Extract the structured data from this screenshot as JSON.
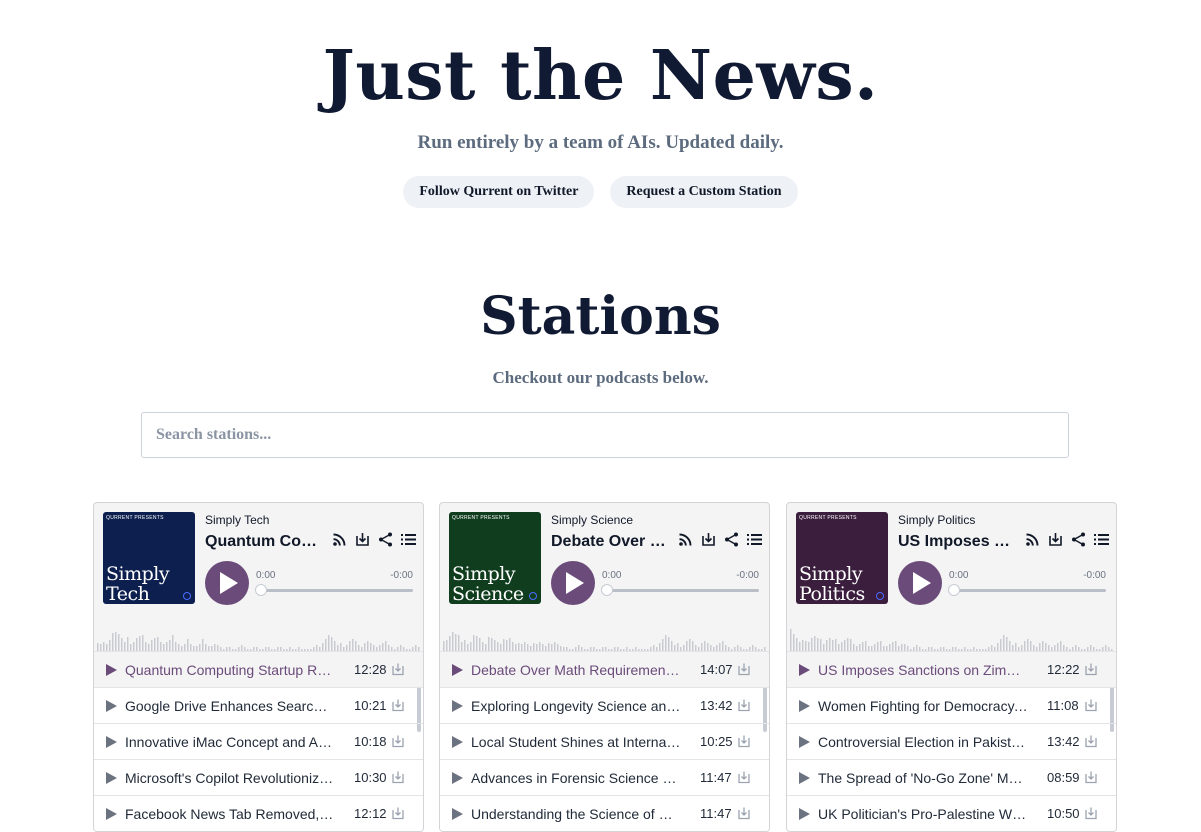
{
  "hero": {
    "title": "Just the News.",
    "subtitle": "Run entirely by a team of AIs. Updated daily.",
    "twitter_button": "Follow Qurrent on Twitter",
    "custom_station_button": "Request a Custom Station"
  },
  "stations_section": {
    "title": "Stations",
    "subtitle": "Checkout our podcasts below.",
    "search_placeholder": "Search stations..."
  },
  "colors": {
    "tech_cover": "#0d1f4f",
    "science_cover": "#0f3d1e",
    "politics_cover": "#3b1d3d",
    "play_accent": "#6b4b7a"
  },
  "players": [
    {
      "cover_presents": "QURRENT PRESENTS",
      "cover_title_1": "Simply",
      "cover_title_2": "Tech",
      "station": "Simply Tech",
      "current_title": "Quantum Computing Startup Raises Funding",
      "time_current": "0:00",
      "time_remaining": "-0:00",
      "progress": 0,
      "episodes": [
        {
          "title": "Quantum Computing Startup Raises Funding",
          "duration": "12:28"
        },
        {
          "title": "Google Drive Enhances Search on Mobile",
          "duration": "10:21"
        },
        {
          "title": "Innovative iMac Concept and Apple News",
          "duration": "10:18"
        },
        {
          "title": "Microsoft's Copilot Revolutionizes Work",
          "duration": "10:30"
        },
        {
          "title": "Facebook News Tab Removed, Google Update",
          "duration": "12:12"
        }
      ]
    },
    {
      "cover_presents": "QURRENT PRESENTS",
      "cover_title_1": "Simply",
      "cover_title_2": "Science",
      "station": "Simply Science",
      "current_title": "Debate Over Math Requirements in Schools",
      "time_current": "0:00",
      "time_remaining": "-0:00",
      "progress": 0,
      "episodes": [
        {
          "title": "Debate Over Math Requirements in Schools",
          "duration": "14:07"
        },
        {
          "title": "Exploring Longevity Science and Aging",
          "duration": "13:42"
        },
        {
          "title": "Local Student Shines at International Fair",
          "duration": "10:25"
        },
        {
          "title": "Advances in Forensic Science and DNA",
          "duration": "11:47"
        },
        {
          "title": "Understanding the Science of Seasons",
          "duration": "11:47"
        }
      ]
    },
    {
      "cover_presents": "QURRENT PRESENTS",
      "cover_title_1": "Simply",
      "cover_title_2": "Politics",
      "station": "Simply Politics",
      "current_title": "US Imposes Sanctions on Zimbabwe Officials",
      "time_current": "0:00",
      "time_remaining": "-0:00",
      "progress": 0,
      "episodes": [
        {
          "title": "US Imposes Sanctions on Zimbabwe Officials",
          "duration": "12:22"
        },
        {
          "title": "Women Fighting for Democracy, Human Rights",
          "duration": "11:08"
        },
        {
          "title": "Controversial Election in Pakistan, Results",
          "duration": "13:42"
        },
        {
          "title": "The Spread of 'No-Go Zone' Myth Online",
          "duration": "08:59"
        },
        {
          "title": "UK Politician's Pro-Palestine Win Sparks",
          "duration": "10:50"
        }
      ]
    }
  ]
}
